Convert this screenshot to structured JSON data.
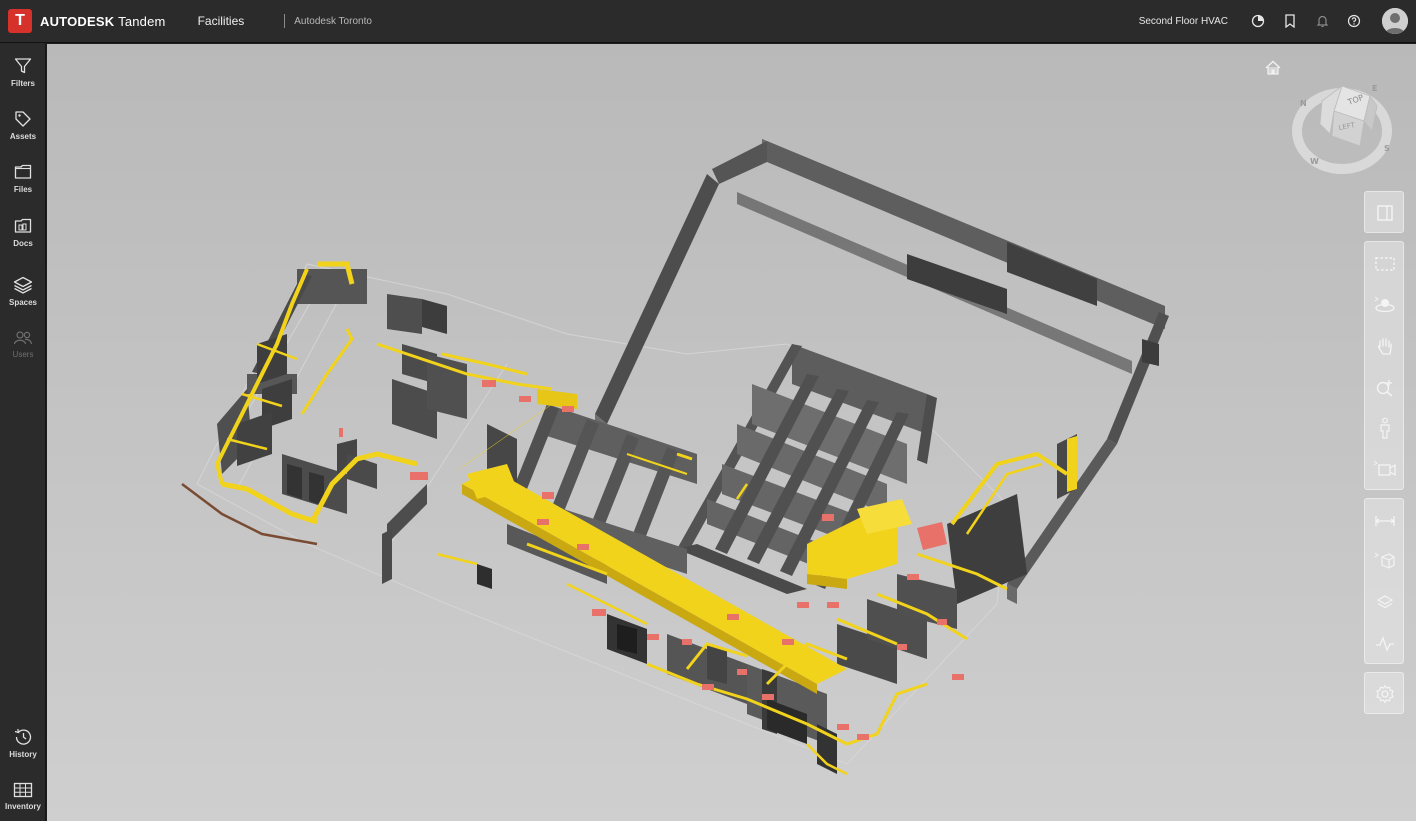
{
  "header": {
    "logo_letter": "T",
    "brand": "AUTODESK",
    "product": "Tandem",
    "module": "Facilities",
    "facility": "Autodesk Toronto",
    "view_name": "Second Floor HVAC",
    "icons": [
      "dashboard-icon",
      "bookmark-icon",
      "bell-icon",
      "help-icon",
      "avatar"
    ]
  },
  "nav": {
    "items": [
      {
        "label": "Filters",
        "icon": "filter-icon"
      },
      {
        "label": "Assets",
        "icon": "tag-icon"
      },
      {
        "label": "Files",
        "icon": "folder-icon"
      },
      {
        "label": "Docs",
        "icon": "docs-icon"
      },
      {
        "label": "Spaces",
        "icon": "layers-icon"
      },
      {
        "label": "Users",
        "icon": "users-icon",
        "disabled": true
      }
    ],
    "bottom": [
      {
        "label": "History",
        "icon": "history-icon"
      },
      {
        "label": "Inventory",
        "icon": "table-icon"
      }
    ]
  },
  "viewcube": {
    "top_face": "TOP",
    "left_face": "LEFT",
    "compass": [
      "N",
      "E",
      "S",
      "W"
    ]
  },
  "toolbar": {
    "icons": [
      "side-panel-icon",
      "section-box-icon",
      "orbit-icon",
      "pan-icon",
      "zoom-icon",
      "first-person-icon",
      "camera-icon",
      "measure-icon",
      "explode-model-icon",
      "layers-icon",
      "activity-icon",
      "settings-icon"
    ]
  },
  "colors": {
    "accent": "#d6322b",
    "duct": "#f2d31b",
    "equipment": "#e8716a",
    "wall": "#5c5c5c"
  }
}
